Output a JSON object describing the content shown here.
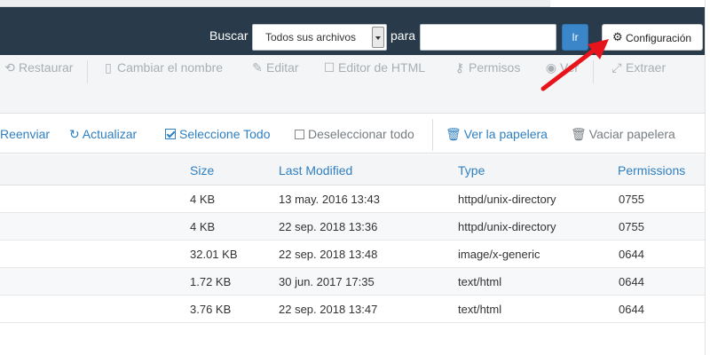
{
  "header": {
    "search_label": "Buscar",
    "scope_select": {
      "value": "Todos sus archivos"
    },
    "para_label": "para",
    "search_input": {
      "value": "",
      "placeholder": ""
    },
    "go_label": "Ir",
    "config_label": "Configuración"
  },
  "toolbar_actions": [
    {
      "label": "Restaurar",
      "icon": "undo-icon"
    },
    {
      "label": "Cambiar el nombre",
      "icon": "file-icon"
    },
    {
      "label": "Editar",
      "icon": "pencil-icon"
    },
    {
      "label": "Editor de HTML",
      "icon": "edit-square-icon"
    },
    {
      "label": "Permisos",
      "icon": "key-icon"
    },
    {
      "label": "Ver",
      "icon": "eye-icon"
    },
    {
      "label": "Extraer",
      "icon": "expand-icon"
    }
  ],
  "toolbar_secondary": [
    {
      "label": "Reenviar"
    },
    {
      "label": "Actualizar",
      "icon": "refresh-icon"
    },
    {
      "label": "Seleccione Todo",
      "icon": "checkbox-checked-icon"
    },
    {
      "label": "Deseleccionar todo",
      "icon": "checkbox-empty-icon"
    },
    {
      "label": "Ver la papelera",
      "icon": "trash-icon"
    },
    {
      "label": "Vaciar papelera",
      "icon": "trash-icon"
    }
  ],
  "table": {
    "columns": [
      "Size",
      "Last Modified",
      "Type",
      "Permissions"
    ],
    "rows": [
      {
        "size": "4 KB",
        "modified": "13 may. 2016 13:43",
        "type": "httpd/unix-directory",
        "perms": "0755"
      },
      {
        "size": "4 KB",
        "modified": "22 sep. 2018 13:36",
        "type": "httpd/unix-directory",
        "perms": "0755"
      },
      {
        "size": "32.01 KB",
        "modified": "22 sep. 2018 13:48",
        "type": "image/x-generic",
        "perms": "0644"
      },
      {
        "size": "1.72 KB",
        "modified": "30 jun. 2017 17:35",
        "type": "text/html",
        "perms": "0644"
      },
      {
        "size": "3.76 KB",
        "modified": "22 sep. 2018 13:47",
        "type": "text/html",
        "perms": "0644"
      }
    ]
  },
  "colors": {
    "header_bg": "#293a4a",
    "accent": "#2f7fc1",
    "go_button": "#3a86c8",
    "annotation_arrow": "#e8141b"
  }
}
